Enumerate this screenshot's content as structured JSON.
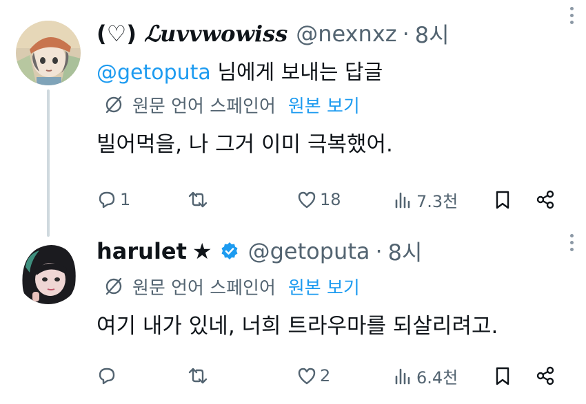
{
  "tweets": [
    {
      "display_name_prefix": "(♡) ",
      "display_name": "ℒuvvwowiss",
      "handle": "@nexnxz",
      "separator": "·",
      "time": "8시",
      "replying_to_mention": "@getoputa",
      "replying_to_suffix": " 님에게 보내는 답글",
      "translation_label": "원문 언어 스페인어",
      "show_original_label": "원본 보기",
      "text": "빌어먹을, 나 그거 이미 극복했어.",
      "replies": "1",
      "retweets": "",
      "likes": "18",
      "views": "7.3천",
      "verified": false
    },
    {
      "display_name": "harulet",
      "star": "★",
      "handle": "@getoputa",
      "separator": "·",
      "time": "8시",
      "translation_label": "원문 언어 스페인어",
      "show_original_label": "원본 보기",
      "text": "여기 내가 있네, 너희 트라우마를 되살리려고.",
      "replies": "",
      "retweets": "",
      "likes": "2",
      "views": "6.4천",
      "verified": true
    }
  ],
  "colors": {
    "link": "#1d9bf0",
    "secondary_text": "#536471",
    "primary_text": "#0f1419",
    "thread_line": "#cfd9de"
  },
  "icons": [
    "reply-icon",
    "retweet-icon",
    "like-icon",
    "views-icon",
    "bookmark-icon",
    "share-icon",
    "translate-icon",
    "more-icon",
    "verified-icon"
  ]
}
